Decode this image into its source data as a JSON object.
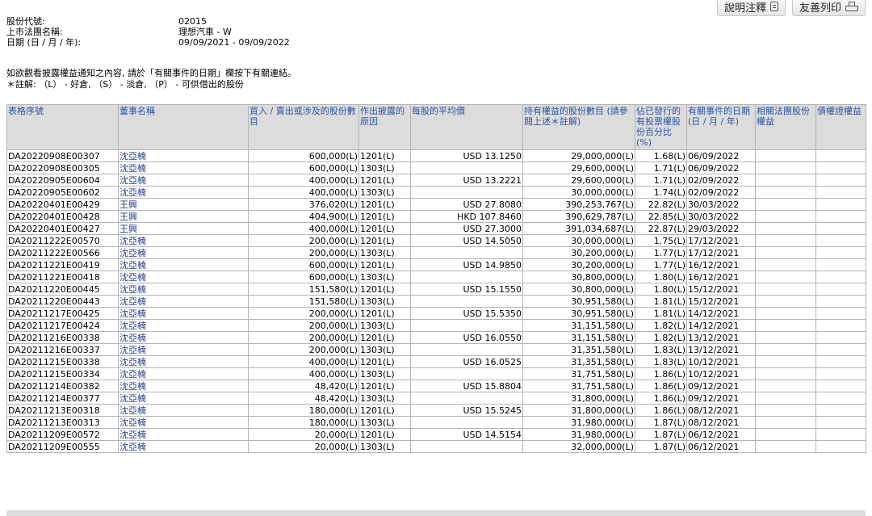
{
  "toolbar": {
    "explain_label": "說明注釋",
    "print_label": "友善列印"
  },
  "info": {
    "stock_code_label": "股份代號:",
    "stock_code": "02015",
    "company_label": "上市法團名稱:",
    "company": "理想汽車 - W",
    "date_label": "日期 (日 / 月 / 年):",
    "date_range": "09/09/2021 - 09/09/2022"
  },
  "note": {
    "line1": "如欲觀看披露權益通知之內容, 請於「有關事件的日期」欄按下有關連結。",
    "line2": "＊註解: （L） - 好倉, （S） - 淡倉, （P） - 可供借出的股份"
  },
  "table": {
    "headers": [
      "表格序號",
      "董事名稱",
      "買入 / 賣出或涉及的股份數目",
      "作出披露的原因",
      "每股的平均價",
      "持有權益的股份數目 (請參閱上述＊註解)",
      "佔已發行的有投票權股份百分比 (%)",
      "有關事件的日期 (日 / 月 / 年)",
      "相關法團股份權益",
      "債權證權益"
    ],
    "rows": [
      [
        "DA20220908E00307",
        "沈亞楠",
        "600,000(L)",
        "1201(L)",
        "USD 13.1250",
        "29,000,000(L)",
        "1.68(L)",
        "06/09/2022"
      ],
      [
        "DA20220908E00305",
        "沈亞楠",
        "600,000(L)",
        "1303(L)",
        "",
        "29,600,000(L)",
        "1.71(L)",
        "06/09/2022"
      ],
      [
        "DA20220905E00604",
        "沈亞楠",
        "400,000(L)",
        "1201(L)",
        "USD 13.2221",
        "29,600,000(L)",
        "1.71(L)",
        "02/09/2022"
      ],
      [
        "DA20220905E00602",
        "沈亞楠",
        "400,000(L)",
        "1303(L)",
        "",
        "30,000,000(L)",
        "1.74(L)",
        "02/09/2022"
      ],
      [
        "DA20220401E00429",
        "王興",
        "376,020(L)",
        "1201(L)",
        "USD 27.8080",
        "390,253,767(L)",
        "22.82(L)",
        "30/03/2022"
      ],
      [
        "DA20220401E00428",
        "王興",
        "404,900(L)",
        "1201(L)",
        "HKD 107.8460",
        "390,629,787(L)",
        "22.85(L)",
        "30/03/2022"
      ],
      [
        "DA20220401E00427",
        "王興",
        "400,000(L)",
        "1201(L)",
        "USD 27.3000",
        "391,034,687(L)",
        "22.87(L)",
        "29/03/2022"
      ],
      [
        "DA20211222E00570",
        "沈亞楠",
        "200,000(L)",
        "1201(L)",
        "USD 14.5050",
        "30,000,000(L)",
        "1.75(L)",
        "17/12/2021"
      ],
      [
        "DA20211222E00566",
        "沈亞楠",
        "200,000(L)",
        "1303(L)",
        "",
        "30,200,000(L)",
        "1.77(L)",
        "17/12/2021"
      ],
      [
        "DA20211221E00419",
        "沈亞楠",
        "600,000(L)",
        "1201(L)",
        "USD 14.9850",
        "30,200,000(L)",
        "1.77(L)",
        "16/12/2021"
      ],
      [
        "DA20211221E00418",
        "沈亞楠",
        "600,000(L)",
        "1303(L)",
        "",
        "30,800,000(L)",
        "1.80(L)",
        "16/12/2021"
      ],
      [
        "DA20211220E00445",
        "沈亞楠",
        "151,580(L)",
        "1201(L)",
        "USD 15.1550",
        "30,800,000(L)",
        "1.80(L)",
        "15/12/2021"
      ],
      [
        "DA20211220E00443",
        "沈亞楠",
        "151,580(L)",
        "1303(L)",
        "",
        "30,951,580(L)",
        "1.81(L)",
        "15/12/2021"
      ],
      [
        "DA20211217E00425",
        "沈亞楠",
        "200,000(L)",
        "1201(L)",
        "USD 15.5350",
        "30,951,580(L)",
        "1.81(L)",
        "14/12/2021"
      ],
      [
        "DA20211217E00424",
        "沈亞楠",
        "200,000(L)",
        "1303(L)",
        "",
        "31,151,580(L)",
        "1.82(L)",
        "14/12/2021"
      ],
      [
        "DA20211216E00338",
        "沈亞楠",
        "200,000(L)",
        "1201(L)",
        "USD 16.0550",
        "31,151,580(L)",
        "1.82(L)",
        "13/12/2021"
      ],
      [
        "DA20211216E00337",
        "沈亞楠",
        "200,000(L)",
        "1303(L)",
        "",
        "31,351,580(L)",
        "1.83(L)",
        "13/12/2021"
      ],
      [
        "DA20211215E00338",
        "沈亞楠",
        "400,000(L)",
        "1201(L)",
        "USD 16.0525",
        "31,351,580(L)",
        "1.83(L)",
        "10/12/2021"
      ],
      [
        "DA20211215E00334",
        "沈亞楠",
        "400,000(L)",
        "1303(L)",
        "",
        "31,751,580(L)",
        "1.86(L)",
        "10/12/2021"
      ],
      [
        "DA20211214E00382",
        "沈亞楠",
        "48,420(L)",
        "1201(L)",
        "USD 15.8804",
        "31,751,580(L)",
        "1.86(L)",
        "09/12/2021"
      ],
      [
        "DA20211214E00377",
        "沈亞楠",
        "48,420(L)",
        "1303(L)",
        "",
        "31,800,000(L)",
        "1.86(L)",
        "09/12/2021"
      ],
      [
        "DA20211213E00318",
        "沈亞楠",
        "180,000(L)",
        "1201(L)",
        "USD 15.5245",
        "31,800,000(L)",
        "1.86(L)",
        "08/12/2021"
      ],
      [
        "DA20211213E00313",
        "沈亞楠",
        "180,000(L)",
        "1303(L)",
        "",
        "31,980,000(L)",
        "1.87(L)",
        "08/12/2021"
      ],
      [
        "DA20211209E00572",
        "沈亞楠",
        "20,000(L)",
        "1201(L)",
        "USD 14.5154",
        "31,980,000(L)",
        "1.87(L)",
        "06/12/2021"
      ],
      [
        "DA20211209E00555",
        "沈亞楠",
        "20,000(L)",
        "1303(L)",
        "",
        "32,000,000(L)",
        "1.87(L)",
        "06/12/2021"
      ]
    ]
  }
}
